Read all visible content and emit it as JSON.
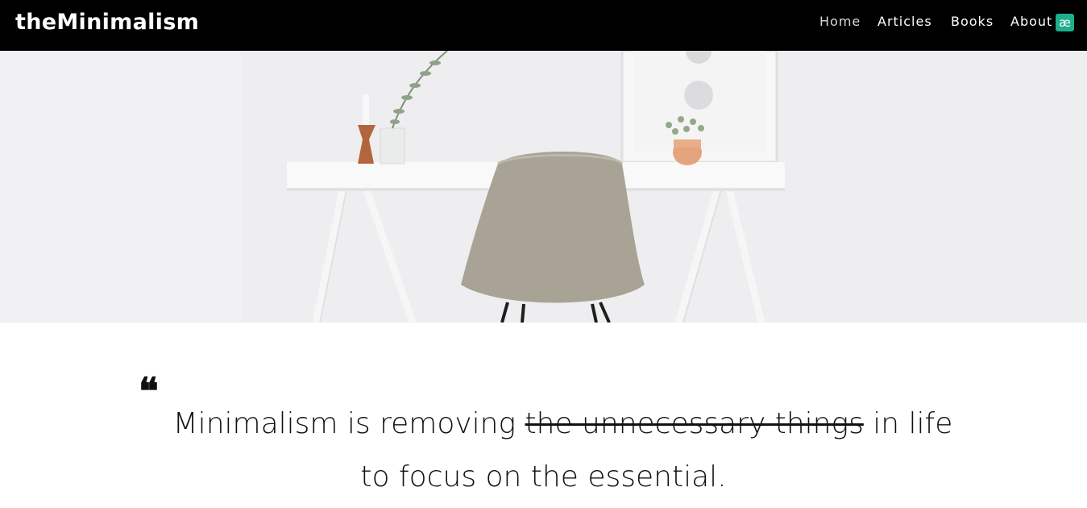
{
  "brand": {
    "title": "theMinimalism"
  },
  "nav": {
    "items": [
      {
        "label": "Home",
        "active": true
      },
      {
        "label": "Articles"
      },
      {
        "label": "Books"
      },
      {
        "label": "About"
      }
    ]
  },
  "extension": {
    "icon": "extension-badge-icon",
    "glyph": "æ",
    "color": "#1fae8c"
  },
  "hero": {
    "image": "minimalist-desk-with-chair-photo"
  },
  "quote": {
    "mark": "❝",
    "before": "Minimalism is removing ",
    "struck": "the unnecessary things",
    "after": " in life",
    "line2": "to focus on the essential."
  },
  "colors": {
    "topbar": "#000000",
    "text": "#111111",
    "accent": "#1fae8c"
  }
}
